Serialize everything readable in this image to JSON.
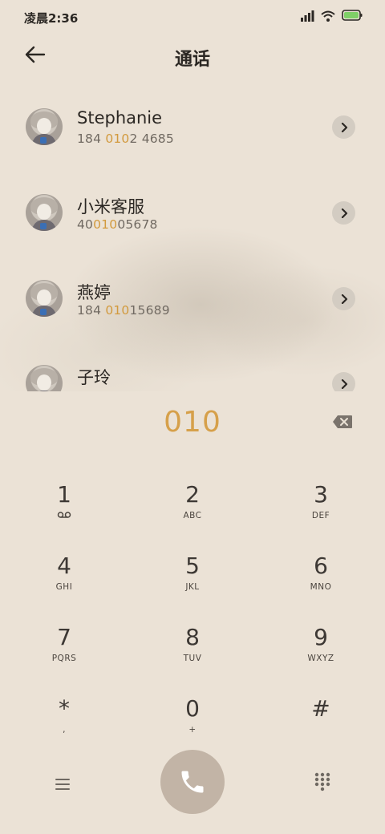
{
  "status_bar": {
    "time": "凌晨2:36",
    "icons": [
      "signal-icon",
      "wifi-icon",
      "battery-icon"
    ],
    "battery_fill": 0.9
  },
  "header": {
    "title": "通话",
    "back_icon": "back-arrow-icon"
  },
  "contacts": [
    {
      "name": "Stephanie",
      "number_pre": "184 ",
      "number_match": "010",
      "number_post": "2 4685"
    },
    {
      "name": "小米客服",
      "number_pre": "40",
      "number_match": "010",
      "number_post": "05678"
    },
    {
      "name": "燕婷",
      "number_pre": "184 ",
      "number_match": "010",
      "number_post": "15689"
    },
    {
      "name": "子玲",
      "number_pre": "",
      "number_match": "",
      "number_post": ""
    }
  ],
  "dialer": {
    "input": "010",
    "keys": [
      {
        "digit": "1",
        "letters": ""
      },
      {
        "digit": "2",
        "letters": "ABC"
      },
      {
        "digit": "3",
        "letters": "DEF"
      },
      {
        "digit": "4",
        "letters": "GHI"
      },
      {
        "digit": "5",
        "letters": "JKL"
      },
      {
        "digit": "6",
        "letters": "MNO"
      },
      {
        "digit": "7",
        "letters": "PQRS"
      },
      {
        "digit": "8",
        "letters": "TUV"
      },
      {
        "digit": "9",
        "letters": "WXYZ"
      },
      {
        "digit": "*",
        "letters": ","
      },
      {
        "digit": "0",
        "letters": "+"
      },
      {
        "digit": "#",
        "letters": ""
      }
    ]
  },
  "colors": {
    "background": "#ebe2d6",
    "accent": "#d6a04a",
    "call_button": "#c2b4a6",
    "battery": "#7fd067"
  }
}
